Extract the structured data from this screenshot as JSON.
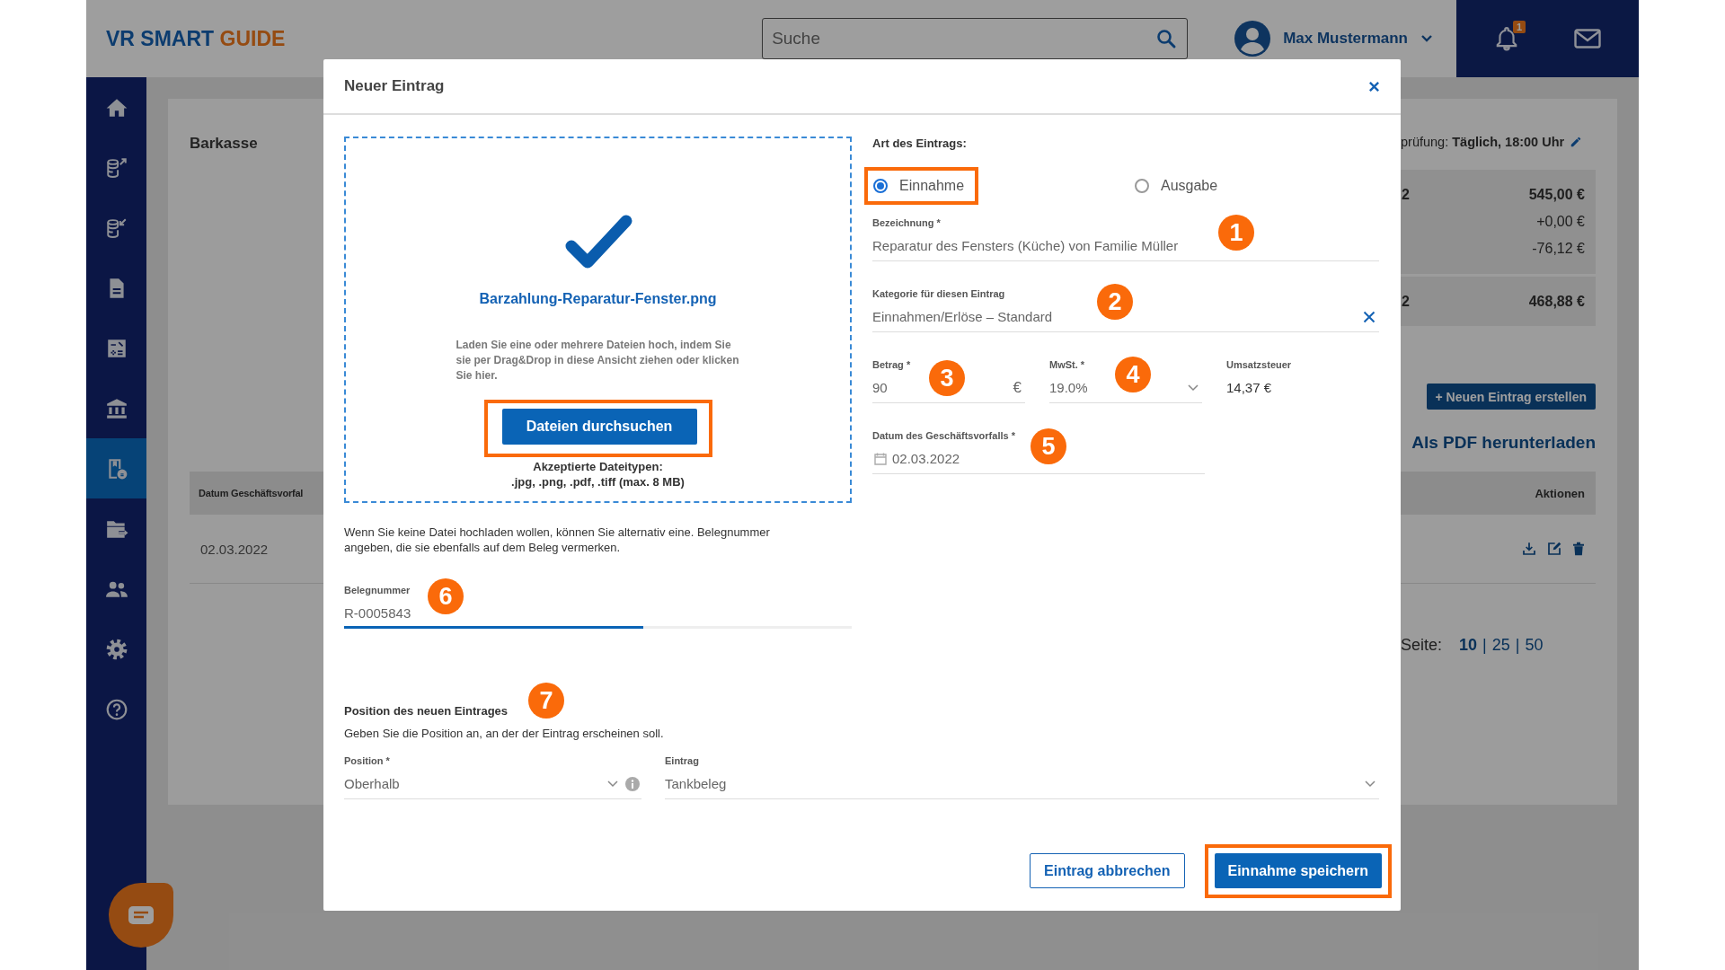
{
  "header": {
    "logo": {
      "text": "VR SMART",
      "accent": "GUIDE"
    },
    "search": {
      "placeholder": "Suche"
    },
    "user": {
      "name": "Max Mustermann"
    },
    "notifications": {
      "badge": "1"
    }
  },
  "sidebar": {
    "items": [
      {
        "kind": "home",
        "selected": false
      },
      {
        "kind": "coins-out",
        "selected": false
      },
      {
        "kind": "coins-in",
        "selected": false
      },
      {
        "kind": "document",
        "selected": false
      },
      {
        "kind": "calculator",
        "selected": false
      },
      {
        "kind": "bank",
        "selected": false
      },
      {
        "kind": "receipt",
        "selected": true
      },
      {
        "kind": "folder",
        "selected": false
      },
      {
        "kind": "people",
        "selected": false
      },
      {
        "kind": "settings",
        "selected": false
      },
      {
        "kind": "help",
        "selected": false
      }
    ]
  },
  "page": {
    "title": "Barkasse",
    "schedule": "prüfung: **Täglich, 18:00 Uhr**",
    "summary_boxes": [
      {
        "rows": [
          {
            "label": "2",
            "amount": "545,00 €",
            "emphasis": true
          },
          {
            "amount": "+0,00 €",
            "emphasis": false
          },
          {
            "amount": "-76,12 €",
            "emphasis": false
          }
        ]
      },
      {
        "rows": [
          {
            "label": "2",
            "amount": "468,88 €",
            "emphasis": true
          }
        ]
      }
    ],
    "new_entry_button": "+ Neuen Eintrag erstellen",
    "pdf_link": "Als PDF herunterladen",
    "table": {
      "columns": [
        "Datum Geschäftsvorfal",
        "Aktionen"
      ],
      "rows": [
        {
          "date": "02.03.2022"
        }
      ]
    },
    "page_size": {
      "label": "Seite:",
      "separator": "|",
      "options": [
        {
          "label": "10",
          "selected": true
        },
        {
          "label": "25",
          "selected": false
        },
        {
          "label": "50",
          "selected": false
        }
      ]
    }
  },
  "dialog": {
    "title": "Neuer Eintrag",
    "upload": {
      "file_name": "Barzahlung-Reparatur-Fenster.png",
      "hint": "Laden Sie eine oder mehrere Dateien hoch, indem Sie sie per Drag&Drop in diese Ansicht ziehen oder klicken Sie hier.",
      "button": {
        "label": "Dateien durchsuchen",
        "highlighted": true
      },
      "accepted_title": "Akzeptierte Dateitypen:",
      "accepted_types": ".jpg, .png, .pdf, .tiff (max. 8 MB)"
    },
    "alternative_note": "Wenn Sie keine Datei hochladen wollen, können Sie alternativ eine. Belegnummer angeben, die sie ebenfalls auf dem Beleg vermerken.",
    "receipt_number": {
      "label": "Belegnummer",
      "value": "R-0005843",
      "level": 0.59,
      "callout": "6"
    },
    "entry_type": {
      "label": "Art des Eintrags:",
      "options": [
        {
          "label": "Einnahme",
          "selected": true,
          "highlighted": true
        },
        {
          "label": "Ausgabe",
          "selected": false,
          "highlighted": false
        }
      ]
    },
    "designation": {
      "label": "Bezeichnung *",
      "value": "Reparatur des Fensters (Küche) von Familie Müller",
      "callout": "1"
    },
    "category": {
      "label": "Kategorie für diesen Eintrag",
      "value": "Einnahmen/Erlöse – Standard",
      "callout": "2"
    },
    "amount": {
      "label": "Betrag *",
      "value": "90",
      "unit": "€",
      "callout": "3"
    },
    "vat": {
      "label": "MwSt. *",
      "value": "19.0%",
      "callout": "4"
    },
    "sales_tax": {
      "label": "Umsatzsteuer",
      "value": "14,37 €"
    },
    "date": {
      "label": "Datum des Geschäftsvorfalls *",
      "value": "02.03.2022",
      "callout": "5"
    },
    "position": {
      "title": "Position des neuen Eintrages",
      "callout": "7",
      "description": "Geben Sie die Position an, an der der Eintrag erscheinen soll.",
      "position_field": {
        "label": "Position *",
        "value": "Oberhalb"
      },
      "entry_field": {
        "label": "Eintrag",
        "value": "Tankbeleg"
      }
    },
    "buttons": [
      {
        "label": "Eintrag abbrechen",
        "kind": "secondary",
        "highlighted": false
      },
      {
        "label": "Einnahme speichern",
        "kind": "primary",
        "highlighted": true
      }
    ]
  }
}
